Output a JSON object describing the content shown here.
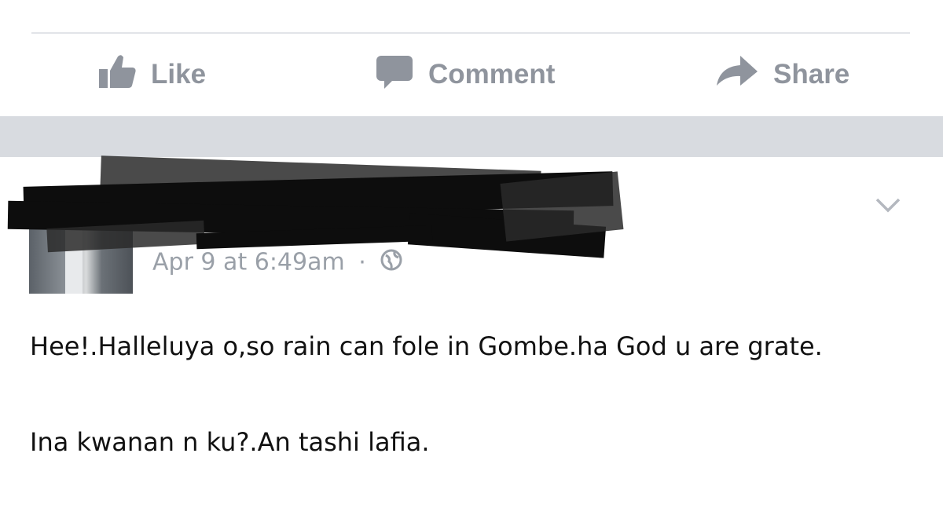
{
  "actions": {
    "like_label": "Like",
    "comment_label": "Comment",
    "share_label": "Share"
  },
  "post": {
    "author_name": "",
    "timestamp": "Apr 9 at 6:49am",
    "separator": "·",
    "privacy_icon": "globe-icon",
    "menu_icon": "chevron-down-icon",
    "paragraphs": [
      "Hee!.Halleluya o,so rain can fole in Gombe.ha God u are grate.",
      "Ina kwanan n ku?.An tashi lafia."
    ]
  },
  "colors": {
    "action_grey": "#8f949d",
    "separator": "#d8dbe0",
    "redaction": "#0d0d0d"
  }
}
